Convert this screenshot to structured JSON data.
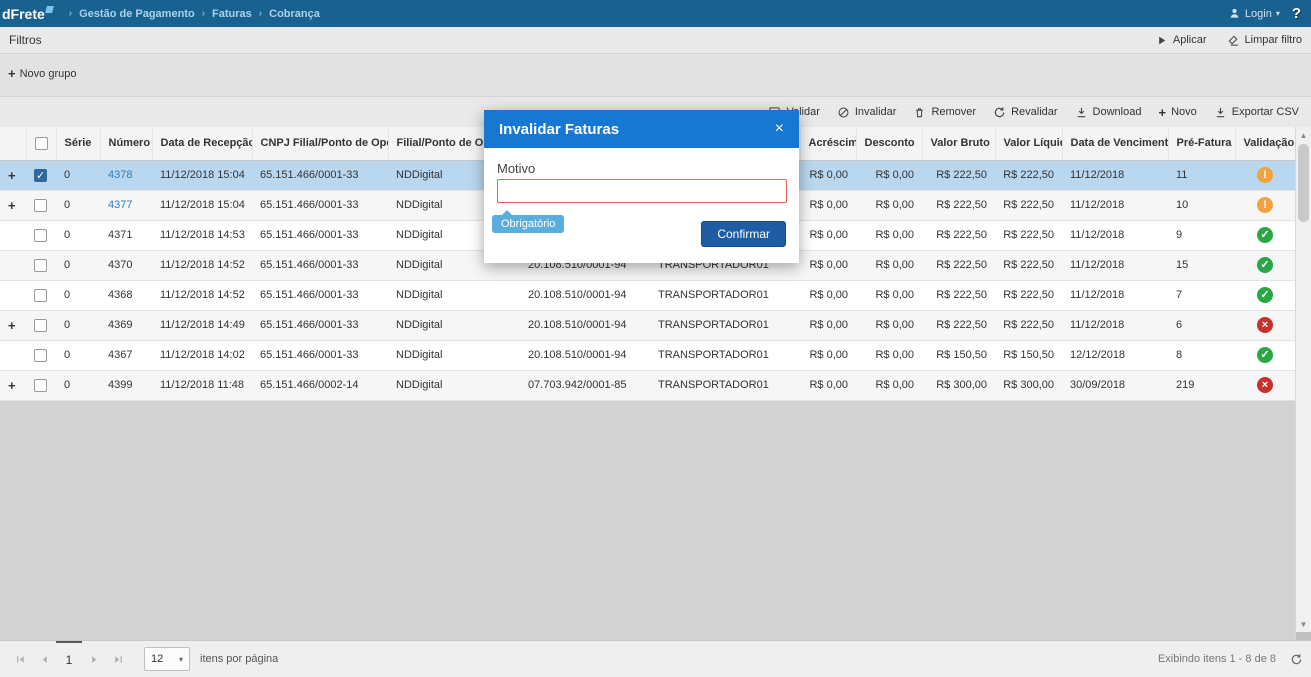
{
  "topbar": {
    "logo": "dFrete",
    "breadcrumb": [
      "Gestão de Pagamento",
      "Faturas",
      "Cobrança"
    ],
    "login_label": "Login",
    "help_label": "?"
  },
  "filters": {
    "title": "Filtros",
    "apply_label": "Aplicar",
    "clear_label": "Limpar filtro"
  },
  "groups": {
    "new_group_label": "Novo grupo"
  },
  "toolbar": {
    "validar": "Validar",
    "invalidar": "Invalidar",
    "remover": "Remover",
    "revalidar": "Revalidar",
    "download": "Download",
    "novo": "Novo",
    "exportar_csv": "Exportar CSV"
  },
  "modal": {
    "title": "Invalidar Faturas",
    "close": "×",
    "motivo_label": "Motivo",
    "motivo_value": "",
    "required_badge": "Obrigatório",
    "confirm_label": "Confirmar"
  },
  "table": {
    "headers": {
      "serie": "Série",
      "numero": "Número",
      "recepcao": "Data de Recepção",
      "sort_arrow": "↓",
      "cnpj_filial": "CNPJ Filial/Ponto de Operação",
      "filial": "Filial/Ponto de Operação",
      "cnpj_transportador": "",
      "transportador": "",
      "acrescimo": "Acréscimo",
      "desconto": "Desconto",
      "valor_bruto": "Valor Bruto",
      "valor_liquido": "Valor Líquido",
      "vencimento": "Data de Vencimento",
      "pre_fatura": "Pré-Fatura",
      "validacao": "Validação"
    },
    "rows": [
      {
        "expand": true,
        "checked": true,
        "selected": true,
        "serie": "0",
        "numero": "4378",
        "numero_link": true,
        "recepcao": "11/12/2018 15:04",
        "cnpj_filial": "65.151.466/0001-33",
        "filial": "NDDigital",
        "cnpj_transportador": "",
        "transportador": "",
        "acrescimo": "R$ 0,00",
        "desconto": "R$ 0,00",
        "valor_bruto": "R$ 222,50",
        "valor_liquido": "R$ 222,50",
        "vencimento": "11/12/2018",
        "pre_fatura": "11",
        "validacao": "warning"
      },
      {
        "expand": true,
        "checked": false,
        "selected": false,
        "serie": "0",
        "numero": "4377",
        "numero_link": true,
        "recepcao": "11/12/2018 15:04",
        "cnpj_filial": "65.151.466/0001-33",
        "filial": "NDDigital",
        "cnpj_transportador": "",
        "transportador": "",
        "acrescimo": "R$ 0,00",
        "desconto": "R$ 0,00",
        "valor_bruto": "R$ 222,50",
        "valor_liquido": "R$ 222,50",
        "vencimento": "11/12/2018",
        "pre_fatura": "10",
        "validacao": "warning"
      },
      {
        "expand": false,
        "checked": false,
        "selected": false,
        "serie": "0",
        "numero": "4371",
        "numero_link": false,
        "recepcao": "11/12/2018 14:53",
        "cnpj_filial": "65.151.466/0001-33",
        "filial": "NDDigital",
        "cnpj_transportador": "",
        "transportador": "",
        "acrescimo": "R$ 0,00",
        "desconto": "R$ 0,00",
        "valor_bruto": "R$ 222,50",
        "valor_liquido": "R$ 222,50",
        "vencimento": "11/12/2018",
        "pre_fatura": "9",
        "validacao": "success"
      },
      {
        "expand": false,
        "checked": false,
        "selected": false,
        "serie": "0",
        "numero": "4370",
        "numero_link": false,
        "recepcao": "11/12/2018 14:52",
        "cnpj_filial": "65.151.466/0001-33",
        "filial": "NDDigital",
        "cnpj_transportador": "20.108.510/0001-94",
        "transportador": "TRANSPORTADOR01",
        "acrescimo": "R$ 0,00",
        "desconto": "R$ 0,00",
        "valor_bruto": "R$ 222,50",
        "valor_liquido": "R$ 222,50",
        "vencimento": "11/12/2018",
        "pre_fatura": "15",
        "validacao": "success"
      },
      {
        "expand": false,
        "checked": false,
        "selected": false,
        "serie": "0",
        "numero": "4368",
        "numero_link": false,
        "recepcao": "11/12/2018 14:52",
        "cnpj_filial": "65.151.466/0001-33",
        "filial": "NDDigital",
        "cnpj_transportador": "20.108.510/0001-94",
        "transportador": "TRANSPORTADOR01",
        "acrescimo": "R$ 0,00",
        "desconto": "R$ 0,00",
        "valor_bruto": "R$ 222,50",
        "valor_liquido": "R$ 222,50",
        "vencimento": "11/12/2018",
        "pre_fatura": "7",
        "validacao": "success"
      },
      {
        "expand": true,
        "checked": false,
        "selected": false,
        "serie": "0",
        "numero": "4369",
        "numero_link": false,
        "recepcao": "11/12/2018 14:49",
        "cnpj_filial": "65.151.466/0001-33",
        "filial": "NDDigital",
        "cnpj_transportador": "20.108.510/0001-94",
        "transportador": "TRANSPORTADOR01",
        "acrescimo": "R$ 0,00",
        "desconto": "R$ 0,00",
        "valor_bruto": "R$ 222,50",
        "valor_liquido": "R$ 222,50",
        "vencimento": "11/12/2018",
        "pre_fatura": "6",
        "validacao": "error"
      },
      {
        "expand": false,
        "checked": false,
        "selected": false,
        "serie": "0",
        "numero": "4367",
        "numero_link": false,
        "recepcao": "11/12/2018 14:02",
        "cnpj_filial": "65.151.466/0001-33",
        "filial": "NDDigital",
        "cnpj_transportador": "20.108.510/0001-94",
        "transportador": "TRANSPORTADOR01",
        "acrescimo": "R$ 0,00",
        "desconto": "R$ 0,00",
        "valor_bruto": "R$ 150,50",
        "valor_liquido": "R$ 150,50",
        "vencimento": "12/12/2018",
        "pre_fatura": "8",
        "validacao": "success"
      },
      {
        "expand": true,
        "checked": false,
        "selected": false,
        "serie": "0",
        "numero": "4399",
        "numero_link": false,
        "recepcao": "11/12/2018 11:48",
        "cnpj_filial": "65.151.466/0002-14",
        "filial": "NDDigital",
        "cnpj_transportador": "07.703.942/0001-85",
        "transportador": "TRANSPORTADOR01",
        "acrescimo": "R$ 0,00",
        "desconto": "R$ 0,00",
        "valor_bruto": "R$ 300,00",
        "valor_liquido": "R$ 300,00",
        "vencimento": "30/09/2018",
        "pre_fatura": "219",
        "validacao": "error"
      }
    ]
  },
  "pagination": {
    "current_page": "1",
    "page_size": "12",
    "items_per_page_label": "itens por página",
    "status": "Exibindo itens 1 - 8 de 8"
  },
  "colors": {
    "topbar": "#19618f",
    "modal_header": "#1777d2",
    "confirm_button": "#1e5da4",
    "selected_row": "#b9d7ee",
    "warning": "#f0a33f",
    "success": "#28a745",
    "error": "#c9302c",
    "required_badge": "#5aaede",
    "input_error_border": "#e06060",
    "link": "#2e7cb8"
  }
}
